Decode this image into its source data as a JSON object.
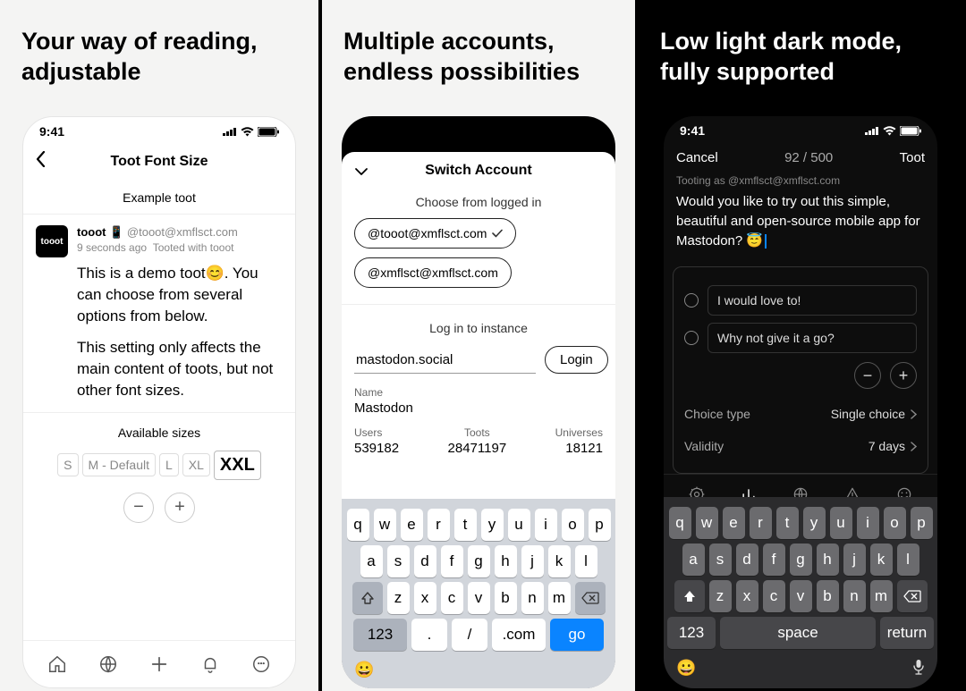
{
  "status_time": "9:41",
  "panel1": {
    "headline": "Your way of reading, adjustable",
    "nav_title": "Toot Font Size",
    "example_label": "Example toot",
    "toot": {
      "avatar_text": "tooot",
      "username": "tooot 📱",
      "handle": "@tooot@xmflsct.com",
      "time": "9 seconds ago",
      "via": "Tooted with tooot",
      "p1": "This is a demo toot😊. You can choose from several options from below.",
      "p2": "This setting only affects the main content of toots, but not other font sizes."
    },
    "sizes_label": "Available sizes",
    "sizes": {
      "s": "S",
      "m": "M - Default",
      "l": "L",
      "xl": "XL",
      "xxl": "XXL"
    }
  },
  "panel2": {
    "headline": "Multiple accounts, endless possibilities",
    "sheet_title": "Switch Account",
    "choose_label": "Choose from logged in",
    "account1": "@tooot@xmflsct.com",
    "account2": "@xmflsct@xmflsct.com",
    "login_instance_label": "Log in to instance",
    "instance_value": "mastodon.social",
    "login_button": "Login",
    "name_label": "Name",
    "name_value": "Mastodon",
    "stats": {
      "users_label": "Users",
      "users_value": "539182",
      "toots_label": "Toots",
      "toots_value": "28471197",
      "universes_label": "Universes",
      "universes_value": "18121"
    },
    "kbd": {
      "num": "123",
      "dot": ".",
      "slash": "/",
      "dotcom": ".com",
      "go": "go"
    }
  },
  "panel3": {
    "headline": "Low light dark mode, fully supported",
    "cancel": "Cancel",
    "count": "92 / 500",
    "toot_btn": "Toot",
    "tooting_as": "Tooting as @xmflsct@xmflsct.com",
    "text": "Would you like to try out this simple, beautiful and open-source mobile app for Mastodon? 😇",
    "poll": {
      "opt1": "I would love to!",
      "opt2": "Why not give it a go?",
      "choice_label": "Choice type",
      "choice_value": "Single choice",
      "validity_label": "Validity",
      "validity_value": "7 days"
    },
    "kbd": {
      "num": "123",
      "space": "space",
      "return": "return"
    }
  },
  "keys": {
    "row1": [
      "q",
      "w",
      "e",
      "r",
      "t",
      "y",
      "u",
      "i",
      "o",
      "p"
    ],
    "row2": [
      "a",
      "s",
      "d",
      "f",
      "g",
      "h",
      "j",
      "k",
      "l"
    ],
    "row3": [
      "z",
      "x",
      "c",
      "v",
      "b",
      "n",
      "m"
    ]
  }
}
